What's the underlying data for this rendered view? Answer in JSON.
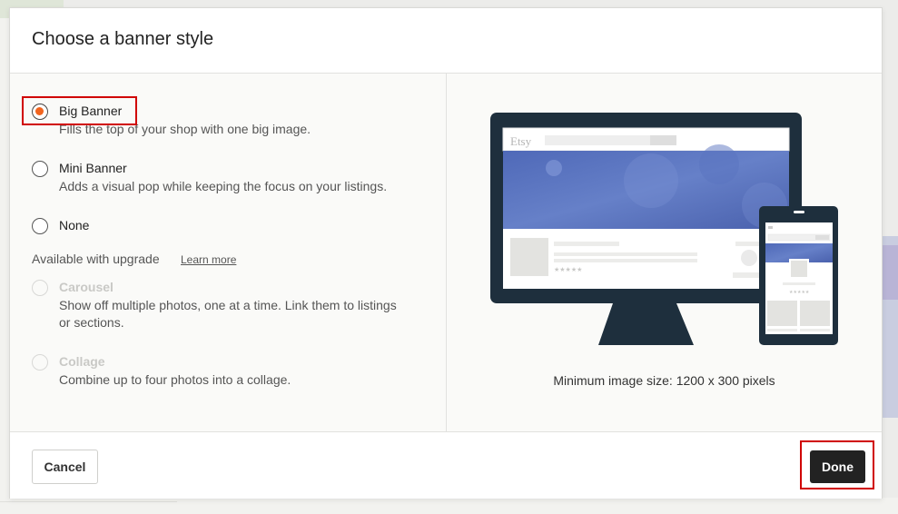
{
  "modal": {
    "title": "Choose a banner style"
  },
  "options": [
    {
      "label": "Big Banner",
      "description": "Fills the top of your shop with one big image.",
      "selected": true,
      "disabled": false
    },
    {
      "label": "Mini Banner",
      "description": "Adds a visual pop while keeping the focus on your listings.",
      "selected": false,
      "disabled": false
    },
    {
      "label": "None",
      "description": "",
      "selected": false,
      "disabled": false
    }
  ],
  "upgrade": {
    "label": "Available with upgrade",
    "learn_more": "Learn more",
    "options": [
      {
        "label": "Carousel",
        "description": "Show off multiple photos, one at a time. Link them to listings or sections.",
        "disabled": true
      },
      {
        "label": "Collage",
        "description": "Combine up to four photos into a collage.",
        "disabled": true
      }
    ]
  },
  "preview": {
    "brand_text": "Etsy",
    "min_size_text": "Minimum image size: 1200 x 300 pixels"
  },
  "footer": {
    "cancel_label": "Cancel",
    "done_label": "Done"
  },
  "colors": {
    "accent": "#f1641e",
    "device_frame": "#1e2f3d",
    "banner_blue": "#5a72c0",
    "highlight": "#d00000"
  }
}
